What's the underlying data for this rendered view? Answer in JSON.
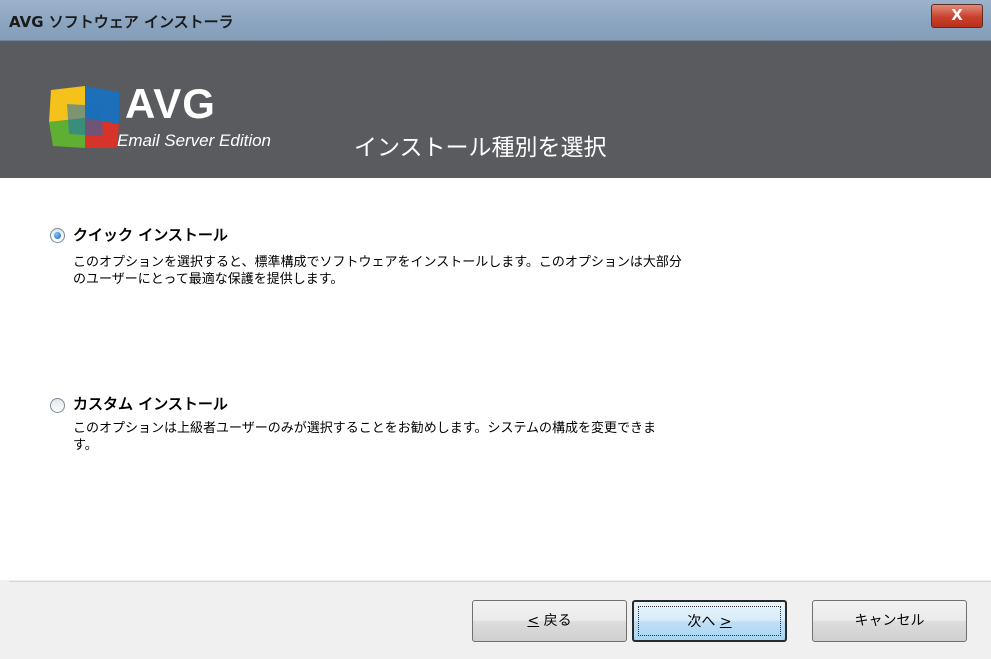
{
  "window": {
    "title": "AVG ソフトウェア インストーラ",
    "close_label": "X"
  },
  "header": {
    "brand": "AVG",
    "edition": "Email Server Edition",
    "title": "インストール種別を選択"
  },
  "options": [
    {
      "label": "クイック インストール",
      "checked": true,
      "description_line1": "このオプションを選択すると、標準構成でソフトウェアをインストールします。このオプションは大部分",
      "description_line2": "のユーザーにとって最適な保護を提供します。"
    },
    {
      "label": "カスタム インストール",
      "checked": false,
      "description_line1": "このオプションは上級者ユーザーのみが選択することをお勧めします。システムの構成を変更できま",
      "description_line2": "す。"
    }
  ],
  "buttons": {
    "back_mnemonic": "<",
    "back_label": " 戻る",
    "next_label": "次へ ",
    "next_mnemonic": ">",
    "cancel_label": "キャンセル"
  },
  "colors": {
    "header_bg": "#5a5b5f",
    "content_bg": "#ffffff",
    "logo_blue": "#1c6fb8",
    "logo_green": "#5fb032",
    "logo_red": "#d8332a",
    "logo_yellow": "#f5c21b"
  }
}
